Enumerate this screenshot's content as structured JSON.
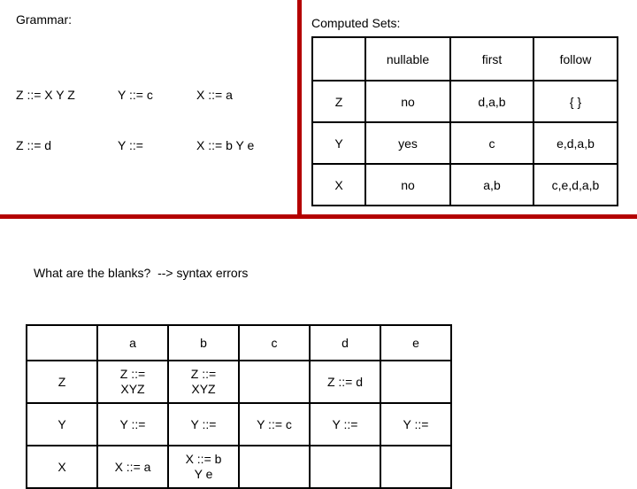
{
  "colors": {
    "rule_red": "#B40000",
    "ink": "#000000",
    "page": "#FFFFFF"
  },
  "grammar": {
    "label": "Grammar:",
    "columns": [
      {
        "rules": [
          "Z ::= X Y Z",
          "Z ::= d"
        ]
      },
      {
        "rules": [
          "Y ::= c",
          "Y ::="
        ]
      },
      {
        "rules": [
          "X ::= a",
          "X ::= b Y e"
        ]
      }
    ]
  },
  "computed_sets": {
    "label": "Computed Sets:",
    "headers": [
      "",
      "nullable",
      "first",
      "follow"
    ],
    "rows": [
      {
        "symbol": "Z",
        "nullable": "no",
        "first": "d,a,b",
        "follow": "{ }"
      },
      {
        "symbol": "Y",
        "nullable": "yes",
        "first": "c",
        "follow": "e,d,a,b"
      },
      {
        "symbol": "X",
        "nullable": "no",
        "first": "a,b",
        "follow": "c,e,d,a,b"
      }
    ]
  },
  "question": {
    "text": "What are the blanks?  --> syntax errors"
  },
  "parse_table": {
    "headers": [
      "",
      "a",
      "b",
      "c",
      "d",
      "e"
    ],
    "rows": [
      {
        "symbol": "Z",
        "cells": [
          "Z ::=\nXYZ",
          "Z ::=\nXYZ",
          "",
          "Z ::= d",
          ""
        ]
      },
      {
        "symbol": "Y",
        "cells": [
          "Y ::=",
          "Y ::=",
          "Y ::= c",
          "Y ::=",
          "Y ::="
        ]
      },
      {
        "symbol": "X",
        "cells": [
          "X ::= a",
          "X ::= b\nY e",
          "",
          "",
          ""
        ]
      }
    ]
  }
}
